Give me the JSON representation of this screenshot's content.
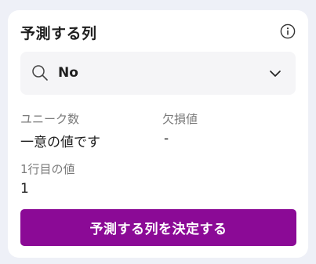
{
  "panel": {
    "title": "予測する列",
    "info_icon": "info-circle-icon"
  },
  "column_select": {
    "icon": "search-icon",
    "value": "No",
    "dropdown_icon": "chevron-down-icon"
  },
  "stats": {
    "unique_label": "ユニーク数",
    "unique_value": "一意の値です",
    "missing_label": "欠損値",
    "missing_value": "-",
    "first_row_label": "1行目の値",
    "first_row_value": "1"
  },
  "action": {
    "confirm_label": "予測する列を決定する"
  },
  "colors": {
    "background": "#eef0f7",
    "card": "#ffffff",
    "select_bg": "#f5f5f7",
    "primary": "#8b0a96",
    "label_gray": "#7a7a7a",
    "text": "#1f1f1f"
  }
}
